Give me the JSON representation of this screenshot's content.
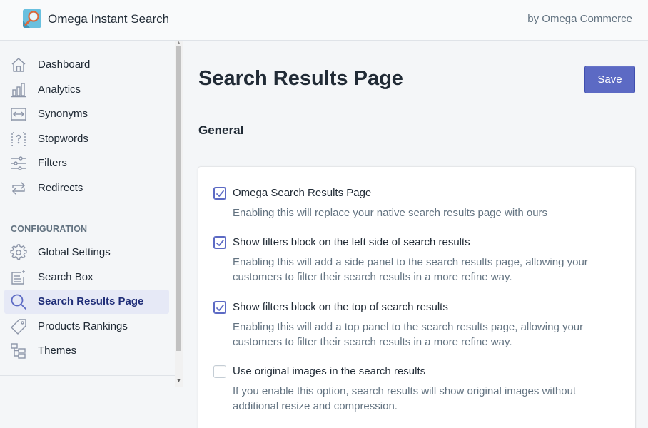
{
  "header": {
    "app_title": "Omega Instant Search",
    "byline": "by Omega Commerce",
    "logo_icon": "magnifier-logo-icon"
  },
  "sidebar": {
    "items": [
      {
        "label": "Dashboard",
        "icon": "home-icon"
      },
      {
        "label": "Analytics",
        "icon": "bar-chart-icon"
      },
      {
        "label": "Synonyms",
        "icon": "arrows-horizontal-icon"
      },
      {
        "label": "Stopwords",
        "icon": "question-bracket-icon"
      },
      {
        "label": "Filters",
        "icon": "sliders-icon"
      },
      {
        "label": "Redirects",
        "icon": "refresh-arrows-icon"
      }
    ],
    "section_label": "CONFIGURATION",
    "config_items": [
      {
        "label": "Global Settings",
        "icon": "gear-icon"
      },
      {
        "label": "Search Box",
        "icon": "document-edit-icon"
      },
      {
        "label": "Search Results Page",
        "icon": "search-icon",
        "active": true
      },
      {
        "label": "Products Rankings",
        "icon": "tag-icon"
      },
      {
        "label": "Themes",
        "icon": "hierarchy-icon"
      }
    ]
  },
  "main": {
    "page_title": "Search Results Page",
    "save_label": "Save",
    "section_title": "General",
    "options": [
      {
        "label": "Omega Search Results Page",
        "help": "Enabling this will replace your native search results page with ours",
        "checked": true
      },
      {
        "label": "Show filters block on the left side of search results",
        "help": "Enabling this will add a side panel to the search results page, allowing your customers to filter their search results in a more refine way.",
        "checked": true
      },
      {
        "label": "Show filters block on the top of search results",
        "help": "Enabling this will add a top panel to the search results page, allowing your customers to filter their search results in a more refine way.",
        "checked": true
      },
      {
        "label": "Use original images in the search results",
        "help": "If you enable this option, search results will show original images without additional resize and compression.",
        "checked": false
      }
    ]
  },
  "colors": {
    "accent": "#5c6ac4",
    "active_nav_bg": "#e6e9f6",
    "active_nav_text": "#202e78",
    "muted_text": "#637381"
  }
}
